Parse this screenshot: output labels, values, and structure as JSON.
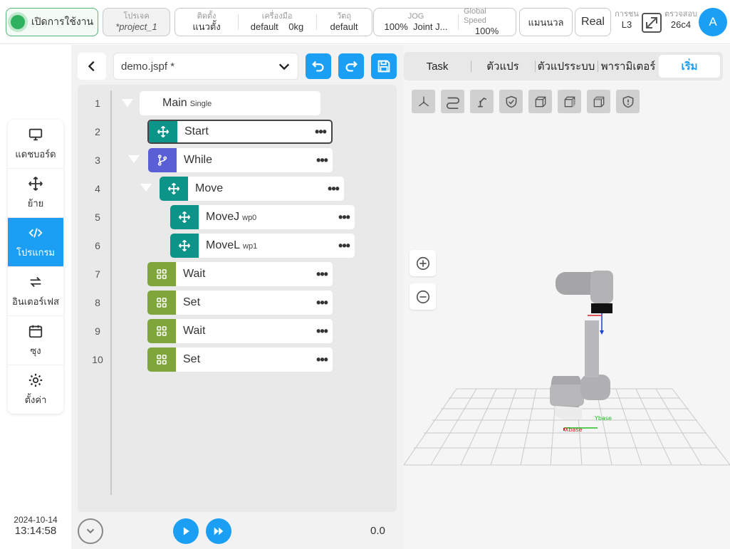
{
  "topbar": {
    "power_label": "เปิดการใช้งาน",
    "project_label": "โปรเจค",
    "project_value": "*project_1",
    "install_label": "ติดตั้ง",
    "install_value": "แนวตั้ง",
    "tool_label": "เครื่องมือ",
    "tool_value": "default",
    "tool_weight": "0kg",
    "object_label": "วัตถุ",
    "object_value": "default",
    "jog_label": "JOG",
    "jog_speed": "100%",
    "jog_mode": "Joint J...",
    "global_speed_label": "Global Speed",
    "global_speed_value": "100%",
    "mode_button": "แมนนวล",
    "real_button": "Real",
    "permission_label": "การชน",
    "permission_value": "L3",
    "check_label": "ตรวจสอบ",
    "check_value": "26c4",
    "avatar_letter": "A",
    "accent_color": "#1a9ff5",
    "power_color": "#2fb25f"
  },
  "nav": {
    "items": [
      {
        "label": "แดชบอร์ด",
        "icon": "monitor-icon"
      },
      {
        "label": "ย้าย",
        "icon": "move-icon"
      },
      {
        "label": "โปรแกรม",
        "icon": "code-icon",
        "active": true
      },
      {
        "label": "อินเตอร์เฟส",
        "icon": "swap-icon"
      },
      {
        "label": "ซุง",
        "icon": "calendar-icon"
      },
      {
        "label": "ตั้งค่า",
        "icon": "gear-icon"
      }
    ]
  },
  "clock": {
    "date": "2024-10-14",
    "time": "13:14:58"
  },
  "program": {
    "file_name": "demo.jspf *",
    "lines": [
      "1",
      "2",
      "3",
      "4",
      "5",
      "6",
      "7",
      "8",
      "9",
      "10"
    ],
    "main_label": "Main",
    "main_mode": "Single",
    "nodes": [
      {
        "label": "Start",
        "param": "",
        "icon": "move-icon",
        "color": "#0d9488"
      },
      {
        "label": "While",
        "param": "",
        "icon": "branch-icon",
        "color": "#5b5fd6"
      },
      {
        "label": "Move",
        "param": "",
        "icon": "move-icon",
        "color": "#0d9488"
      },
      {
        "label": "MoveJ",
        "param": "wp0",
        "icon": "move-icon",
        "color": "#0d9488"
      },
      {
        "label": "MoveL",
        "param": "wp1",
        "icon": "move-icon",
        "color": "#0d9488"
      },
      {
        "label": "Wait",
        "param": "",
        "icon": "grid-icon",
        "color": "#7fa63a"
      },
      {
        "label": "Set",
        "param": "",
        "icon": "grid-icon",
        "color": "#7fa63a"
      },
      {
        "label": "Wait",
        "param": "",
        "icon": "grid-icon",
        "color": "#7fa63a"
      },
      {
        "label": "Set",
        "param": "",
        "icon": "grid-icon",
        "color": "#7fa63a"
      }
    ],
    "more_glyph": "•••",
    "speed_readout": "0.0"
  },
  "right": {
    "tabs": [
      "Task",
      "ตัวแปร",
      "ตัวแปรระบบ",
      "พารามิเตอร์",
      "เริ่ม"
    ],
    "active_tab": "เริ่ม",
    "axis_x": "Xbase",
    "axis_y": "Ybase"
  }
}
